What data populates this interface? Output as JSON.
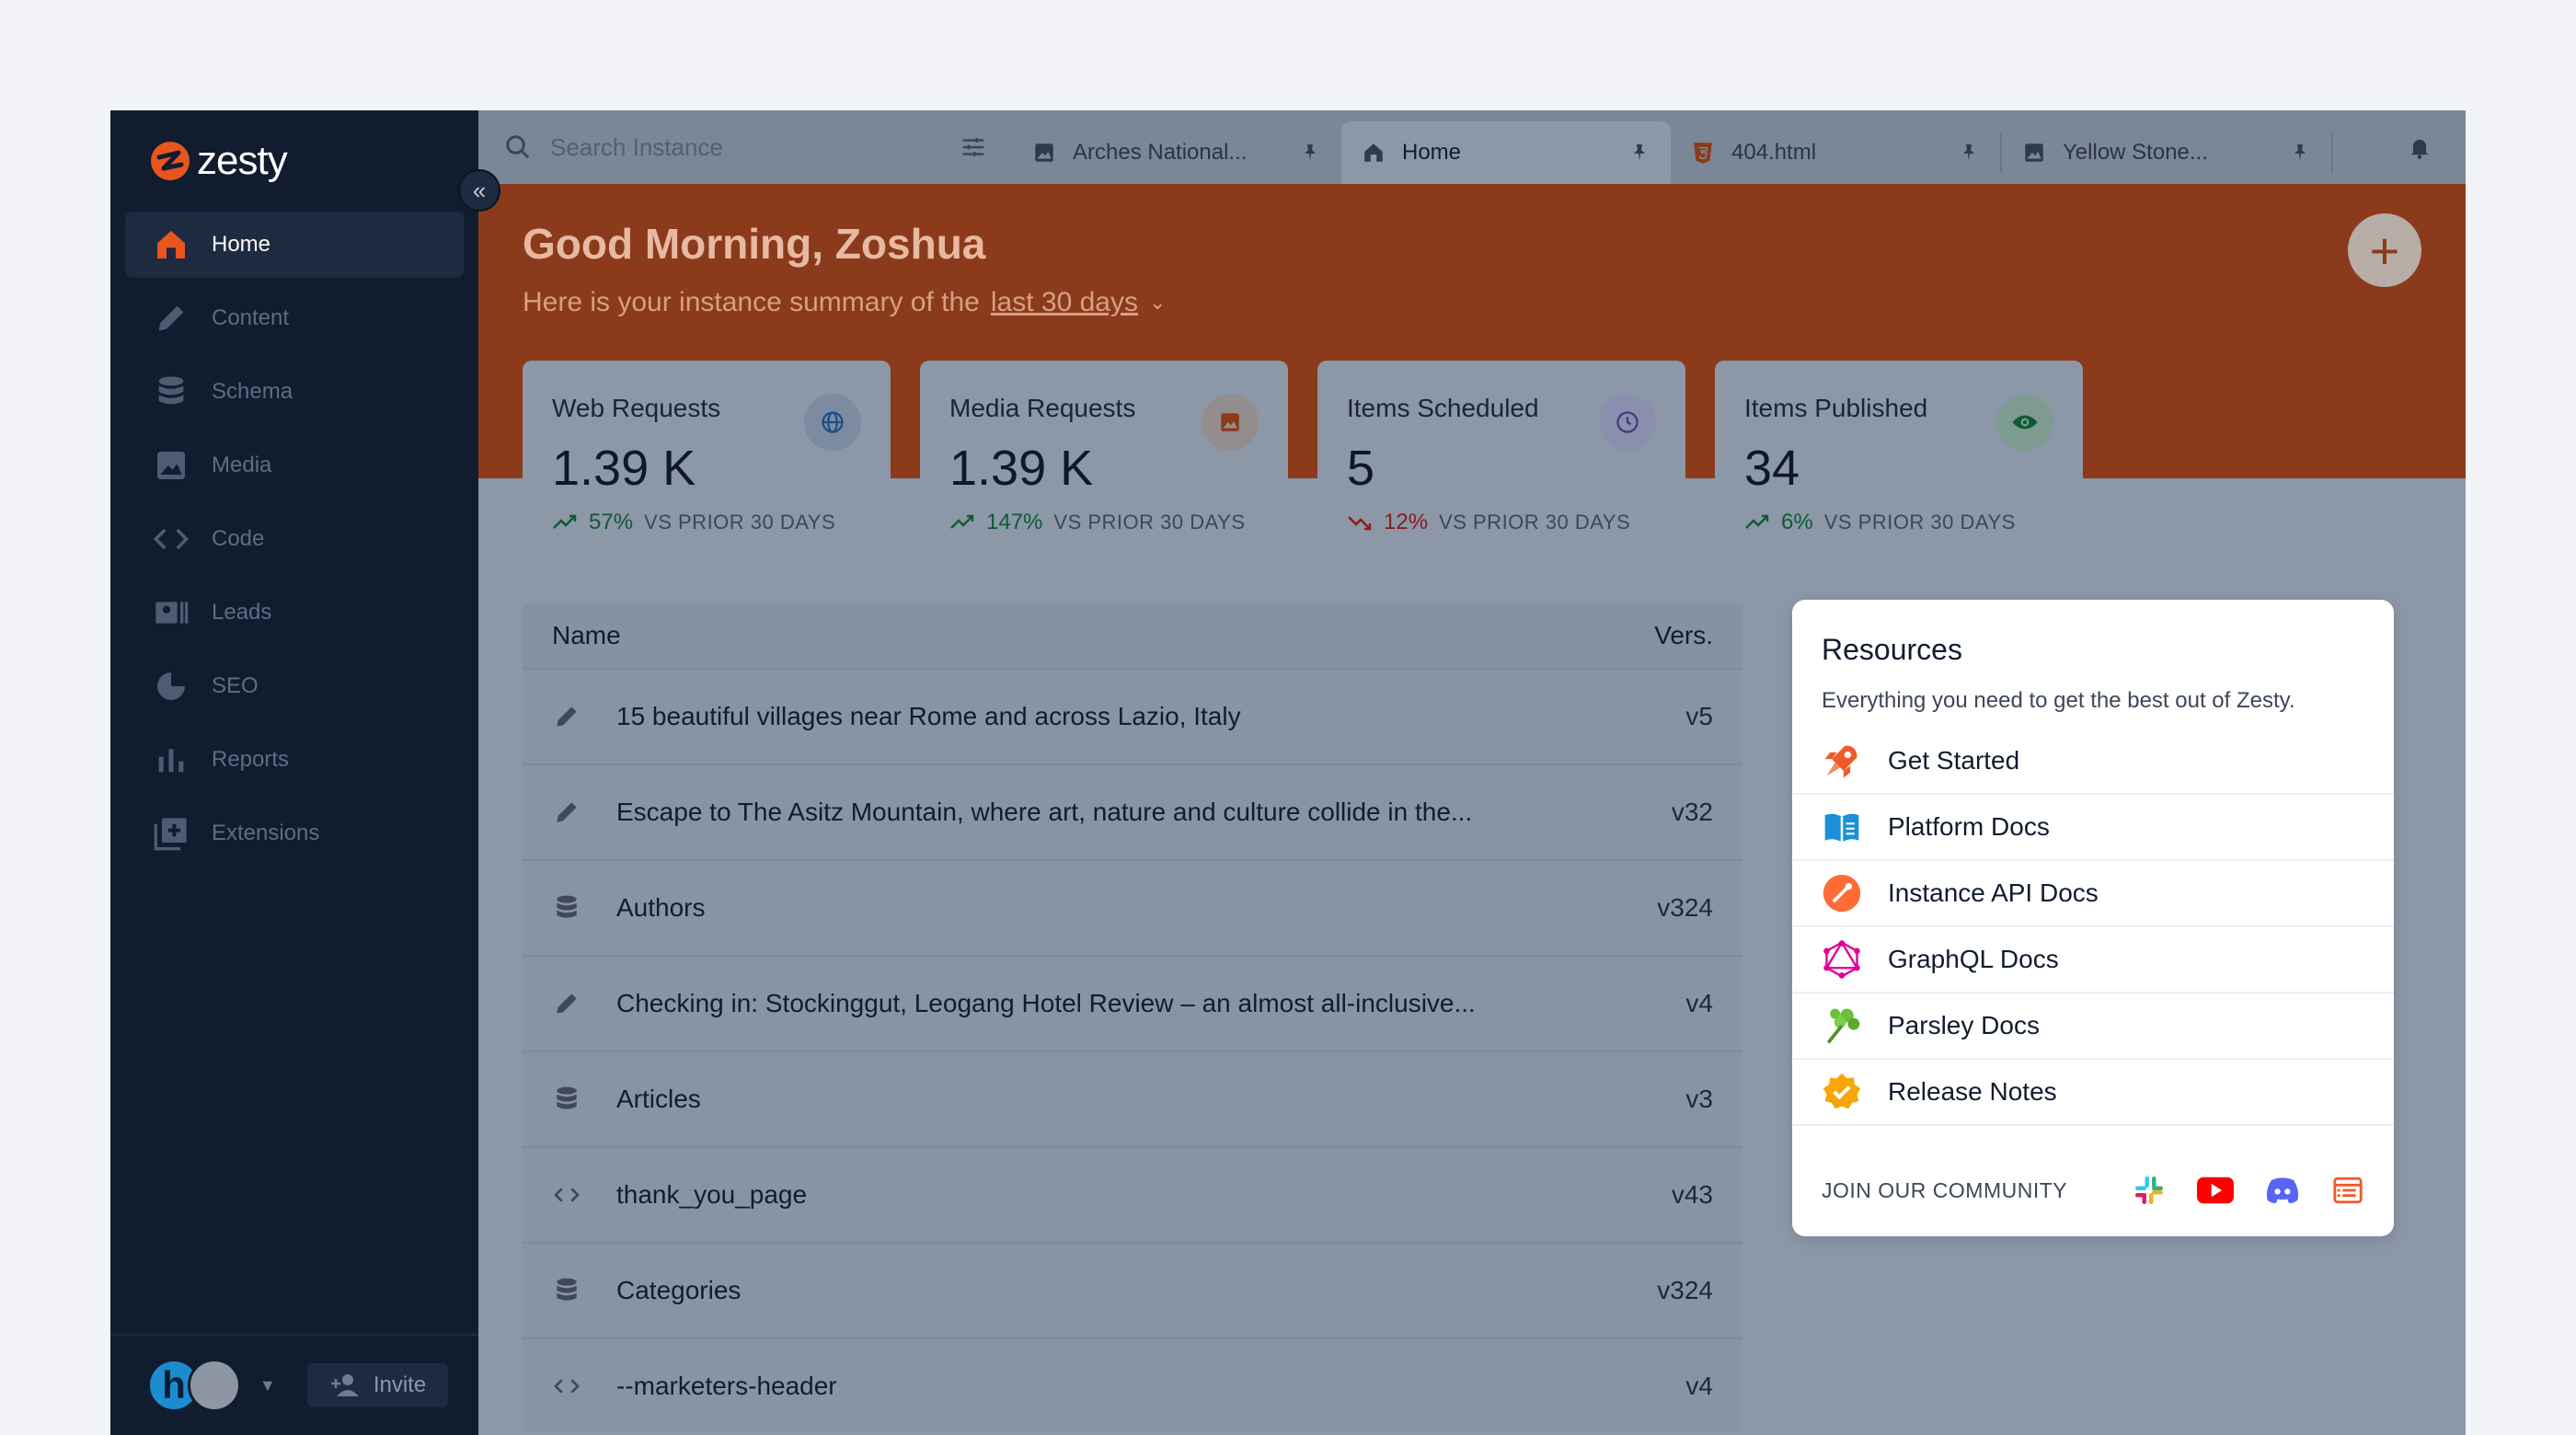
{
  "brand": {
    "name": "zesty",
    "accent": "#e8551f"
  },
  "sidebar": {
    "items": [
      {
        "label": "Home",
        "icon": "home-icon",
        "active": true
      },
      {
        "label": "Content",
        "icon": "pencil-icon"
      },
      {
        "label": "Schema",
        "icon": "database-icon"
      },
      {
        "label": "Media",
        "icon": "image-icon"
      },
      {
        "label": "Code",
        "icon": "code-icon"
      },
      {
        "label": "Leads",
        "icon": "contact-card-icon"
      },
      {
        "label": "SEO",
        "icon": "pie-chart-icon"
      },
      {
        "label": "Reports",
        "icon": "bar-chart-icon"
      },
      {
        "label": "Extensions",
        "icon": "add-box-icon"
      }
    ],
    "avatar_initial": "h",
    "invite_label": "Invite"
  },
  "topbar": {
    "search_placeholder": "Search Instance",
    "tabs": [
      {
        "label": "Arches National...",
        "icon": "image-icon"
      },
      {
        "label": "Home",
        "icon": "home-icon",
        "active": true
      },
      {
        "label": "404.html",
        "icon": "html5-icon"
      },
      {
        "label": "Yellow Stone...",
        "icon": "image-icon"
      }
    ]
  },
  "header": {
    "greeting": "Good Morning, Zoshua",
    "summary_prefix": "Here is your instance summary of the",
    "summary_range": "last 30 days"
  },
  "stats": [
    {
      "label": "Web Requests",
      "value": "1.39 K",
      "pct": "57%",
      "trend": "up",
      "vs": "VS PRIOR 30 DAYS",
      "icon": "globe-icon"
    },
    {
      "label": "Media Requests",
      "value": "1.39 K",
      "pct": "147%",
      "trend": "up",
      "vs": "VS PRIOR 30 DAYS",
      "icon": "image-icon"
    },
    {
      "label": "Items Scheduled",
      "value": "5",
      "pct": "12%",
      "trend": "down",
      "vs": "VS PRIOR 30 DAYS",
      "icon": "clock-icon"
    },
    {
      "label": "Items Published",
      "value": "34",
      "pct": "6%",
      "trend": "up",
      "vs": "VS PRIOR 30 DAYS",
      "icon": "eye-icon"
    }
  ],
  "table": {
    "col_name": "Name",
    "col_vers": "Vers.",
    "rows": [
      {
        "name": "15 beautiful villages near Rome and across Lazio, Italy",
        "vers": "v5",
        "icon": "pencil-icon"
      },
      {
        "name": "Escape to The Asitz Mountain, where art, nature and culture collide in the...",
        "vers": "v32",
        "icon": "pencil-icon"
      },
      {
        "name": "Authors",
        "vers": "v324",
        "icon": "database-icon"
      },
      {
        "name": "Checking in: Stockinggut, Leogang Hotel Review – an almost all-inclusive...",
        "vers": "v4",
        "icon": "pencil-icon"
      },
      {
        "name": "Articles",
        "vers": "v3",
        "icon": "database-icon"
      },
      {
        "name": "thank_you_page",
        "vers": "v43",
        "icon": "code-icon"
      },
      {
        "name": "Categories",
        "vers": "v324",
        "icon": "database-icon"
      },
      {
        "name": "--marketers-header",
        "vers": "v4",
        "icon": "code-icon"
      }
    ]
  },
  "resources": {
    "title": "Resources",
    "subtitle": "Everything you need to get the best out of Zesty.",
    "items": [
      {
        "label": "Get Started",
        "icon": "rocket-icon"
      },
      {
        "label": "Platform Docs",
        "icon": "book-icon"
      },
      {
        "label": "Instance API Docs",
        "icon": "postman-icon"
      },
      {
        "label": "GraphQL Docs",
        "icon": "graphql-icon"
      },
      {
        "label": "Parsley Docs",
        "icon": "parsley-icon"
      },
      {
        "label": "Release Notes",
        "icon": "verified-badge-icon"
      }
    ],
    "community_label": "JOIN OUR COMMUNITY",
    "community_icons": [
      "slack-icon",
      "youtube-icon",
      "discord-icon",
      "zesty-community-icon"
    ]
  }
}
